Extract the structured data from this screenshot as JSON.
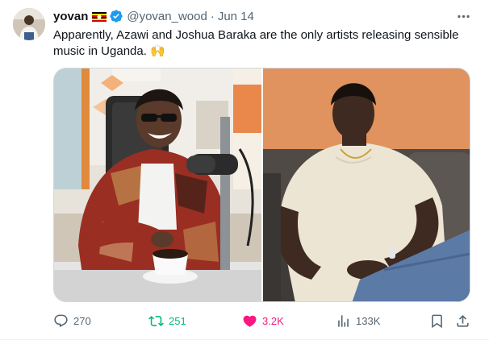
{
  "tweet": {
    "author_name": "yovan",
    "handle": "@yovan_wood",
    "separator": "·",
    "time": "Jun 14",
    "text": "Apparently, Azawi and Joshua Baraka are the only artists releasing sensible music in Uganda. 🙌",
    "icons": {
      "flag": "uganda-flag-icon",
      "verified": "verified-badge-icon",
      "more": "more-icon"
    },
    "media": [
      {
        "name": "photo-left",
        "description_icon": "image"
      },
      {
        "name": "photo-right",
        "description_icon": "image"
      }
    ]
  },
  "actions": {
    "replies": "270",
    "reposts": "251",
    "likes": "3.2K",
    "views": "133K"
  },
  "colors": {
    "text_primary": "#0f1419",
    "text_secondary": "#536471",
    "repost_active": "#00ba7c",
    "like_active": "#f91880",
    "verified": "#1d9bf0",
    "border": "#cfd9de"
  }
}
